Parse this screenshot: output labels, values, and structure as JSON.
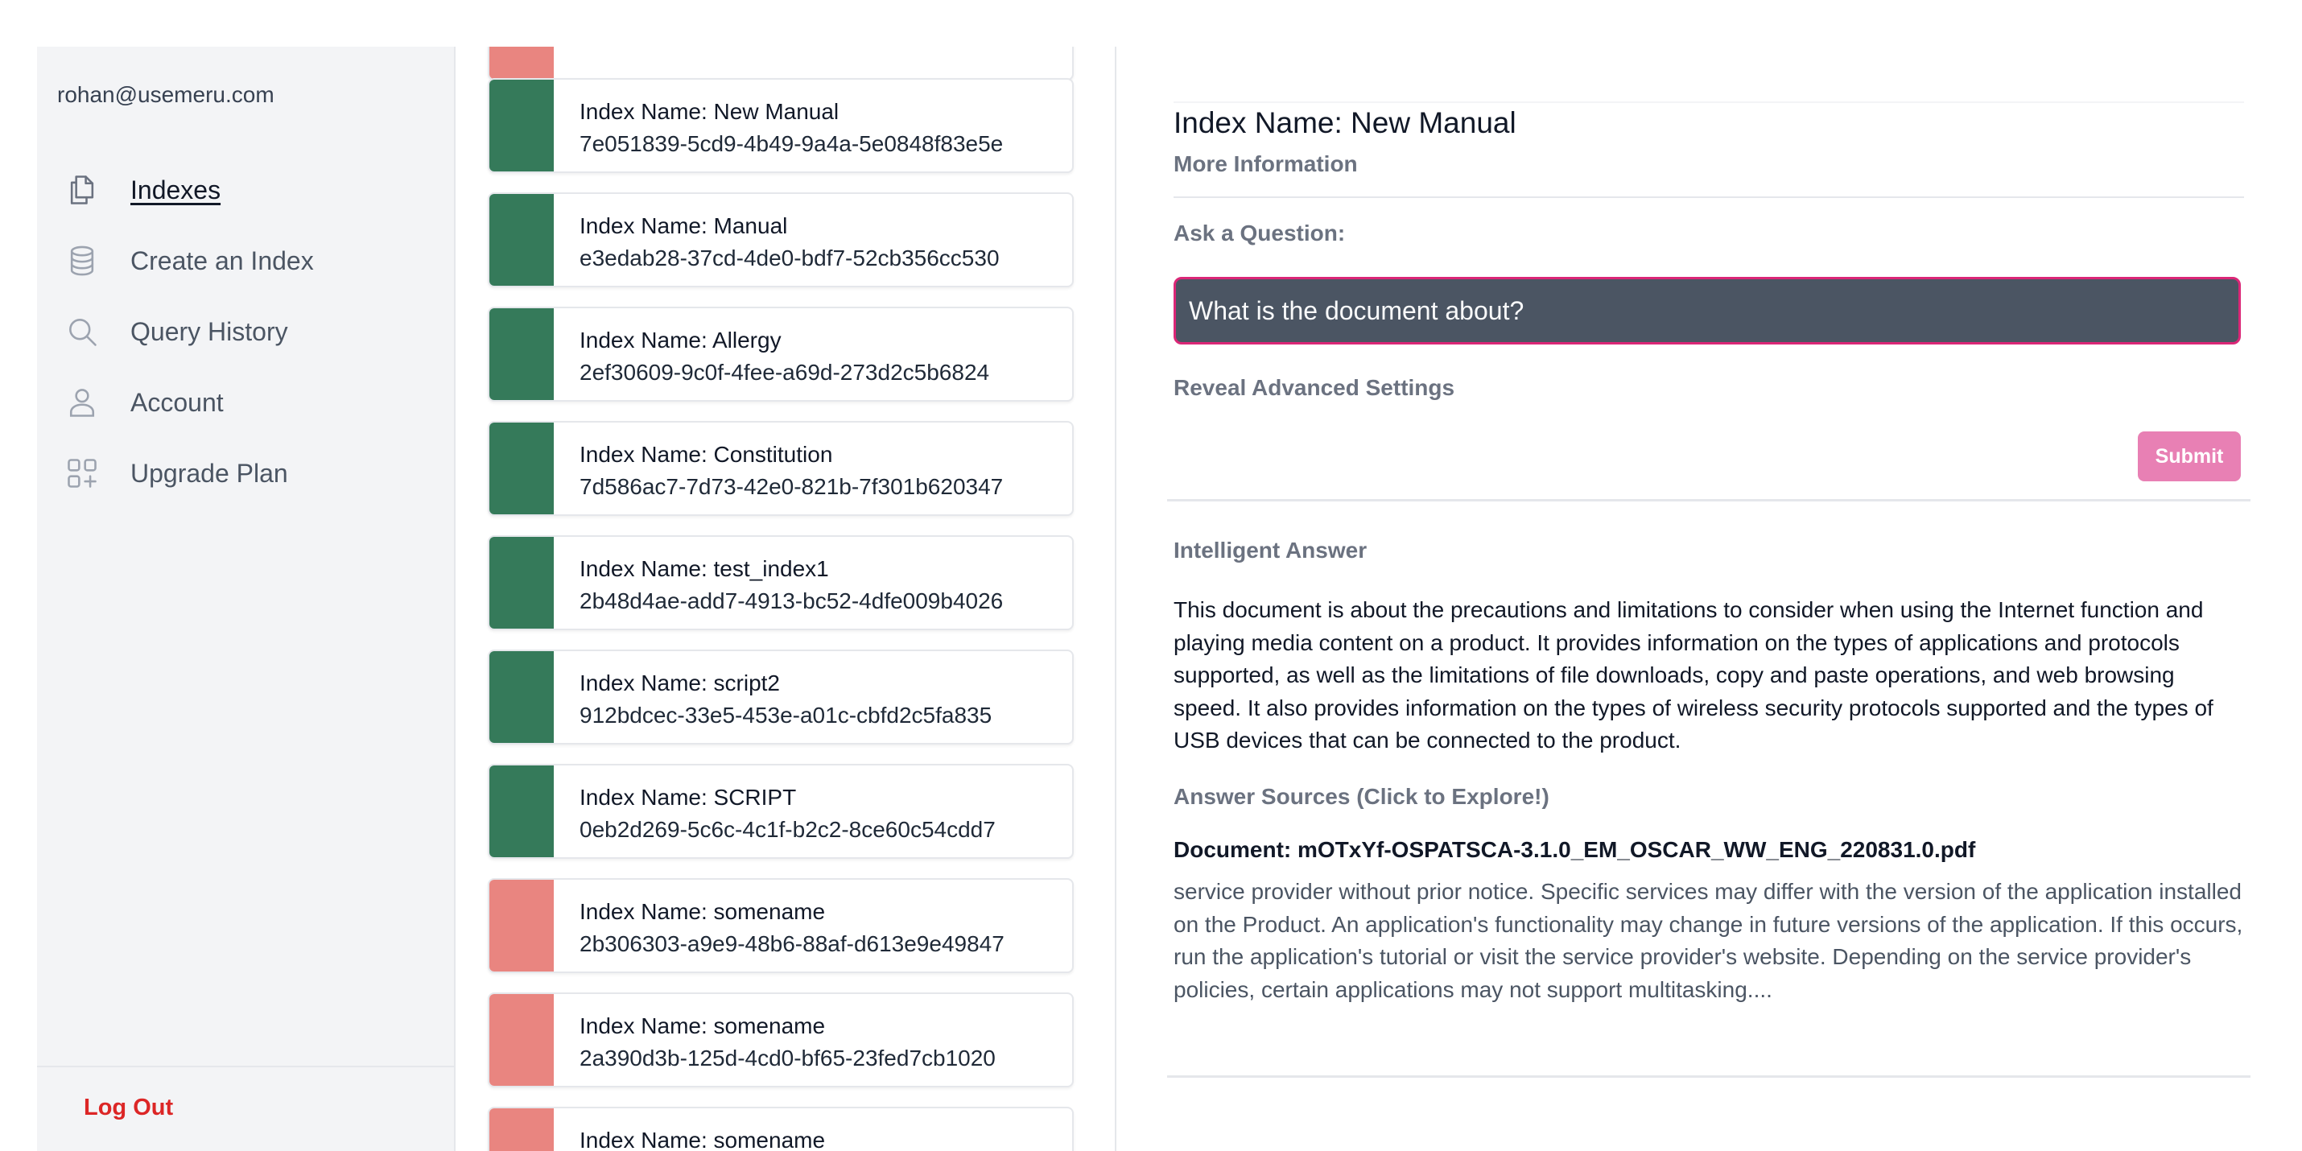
{
  "colors": {
    "active_index": "#357a5a",
    "inactive_index": "#e98580",
    "accent": "#db2777",
    "logout": "#dc2626"
  },
  "sidebar": {
    "user_email": "rohan@usemeru.com",
    "items": [
      {
        "label": "Indexes",
        "icon": "copy-icon",
        "active": true
      },
      {
        "label": "Create an Index",
        "icon": "database-icon",
        "active": false
      },
      {
        "label": "Query History",
        "icon": "search-icon",
        "active": false
      },
      {
        "label": "Account",
        "icon": "user-icon",
        "active": false
      },
      {
        "label": "Upgrade Plan",
        "icon": "apps-plus-icon",
        "active": false
      }
    ],
    "logout_label": "Log Out"
  },
  "index_list": [
    {
      "name": "",
      "id": "",
      "status": "inactive"
    },
    {
      "name": "Index Name: New Manual",
      "id": "7e051839-5cd9-4b49-9a4a-5e0848f83e5e",
      "status": "active"
    },
    {
      "name": "Index Name: Manual",
      "id": "e3edab28-37cd-4de0-bdf7-52cb356cc530",
      "status": "active"
    },
    {
      "name": "Index Name: Allergy",
      "id": "2ef30609-9c0f-4fee-a69d-273d2c5b6824",
      "status": "active"
    },
    {
      "name": "Index Name: Constitution",
      "id": "7d586ac7-7d73-42e0-821b-7f301b620347",
      "status": "active"
    },
    {
      "name": "Index Name: test_index1",
      "id": "2b48d4ae-add7-4913-bc52-4dfe009b4026",
      "status": "active"
    },
    {
      "name": "Index Name: script2",
      "id": "912bdcec-33e5-453e-a01c-cbfd2c5fa835",
      "status": "active"
    },
    {
      "name": "Index Name: SCRIPT",
      "id": "0eb2d269-5c6c-4c1f-b2c2-8ce60c54cdd7",
      "status": "active"
    },
    {
      "name": "Index Name: somename",
      "id": "2b306303-a9e9-48b6-88af-d613e9e49847",
      "status": "inactive"
    },
    {
      "name": "Index Name: somename",
      "id": "2a390d3b-125d-4cd0-bf65-23fed7cb1020",
      "status": "inactive"
    },
    {
      "name": "Index Name: somename",
      "id": "",
      "status": "inactive"
    }
  ],
  "detail": {
    "title": "Index Name: New Manual",
    "more_info_label": "More Information",
    "ask_label": "Ask a Question:",
    "question_value": "What is the document about?",
    "reveal_label": "Reveal Advanced Settings",
    "submit_label": "Submit",
    "answer_label": "Intelligent Answer",
    "answer_text": "This document is about the precautions and limitations to consider when using the Internet function and playing media content on a product. It provides information on the types of applications and protocols supported, as well as the limitations of file downloads, copy and paste operations, and web browsing speed. It also provides information on the types of wireless security protocols supported and the types of USB devices that can be connected to the product.",
    "sources_label": "Answer Sources (Click to Explore!)",
    "source_document": "Document: mOTxYf-OSPATSCA-3.1.0_EM_OSCAR_WW_ENG_220831.0.pdf",
    "source_excerpt": "service provider without prior notice. Specific services may differ with the version of the application installed on the Product. An application's functionality may change in future versions of the application. If this occurs, run the application's tutorial or visit the service provider's website. Depending on the service provider's policies, certain applications may not support multitasking...."
  }
}
